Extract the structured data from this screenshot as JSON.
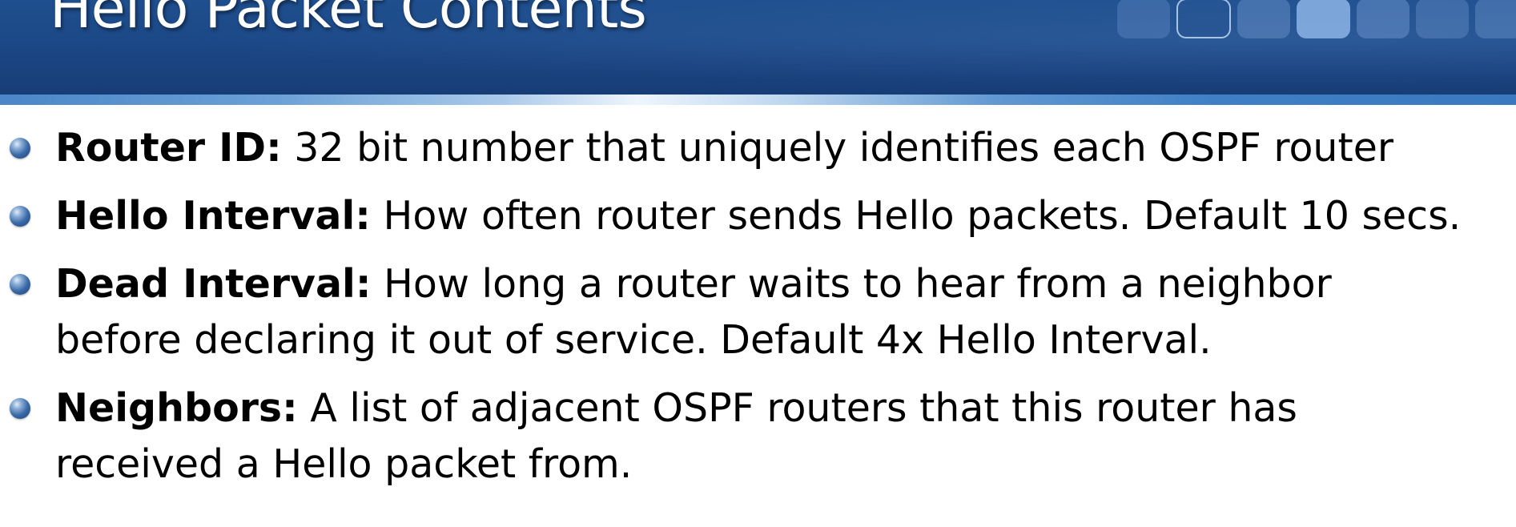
{
  "slide": {
    "title": "Hello Packet Contents",
    "colors": {
      "header": "#1b4684",
      "title_text": "#ffffff",
      "body_text": "#000000",
      "bullet": "#3a6aa7"
    }
  },
  "bullets": [
    {
      "term": "Router ID:",
      "line1": "32 bit number that uniquely identifies each OSPF router",
      "line2": ""
    },
    {
      "term": "Hello Interval:",
      "line1": "How often router sends Hello packets. Default 10 secs.",
      "line2": ""
    },
    {
      "term": "Dead Interval:",
      "line1": "How long a router waits to hear from a neighbor",
      "line2": "before declaring it out of service. Default 4x Hello Interval."
    },
    {
      "term": "Neighbors:",
      "line1": "A list of adjacent OSPF routers that this router has",
      "line2": "received a Hello packet from."
    }
  ]
}
